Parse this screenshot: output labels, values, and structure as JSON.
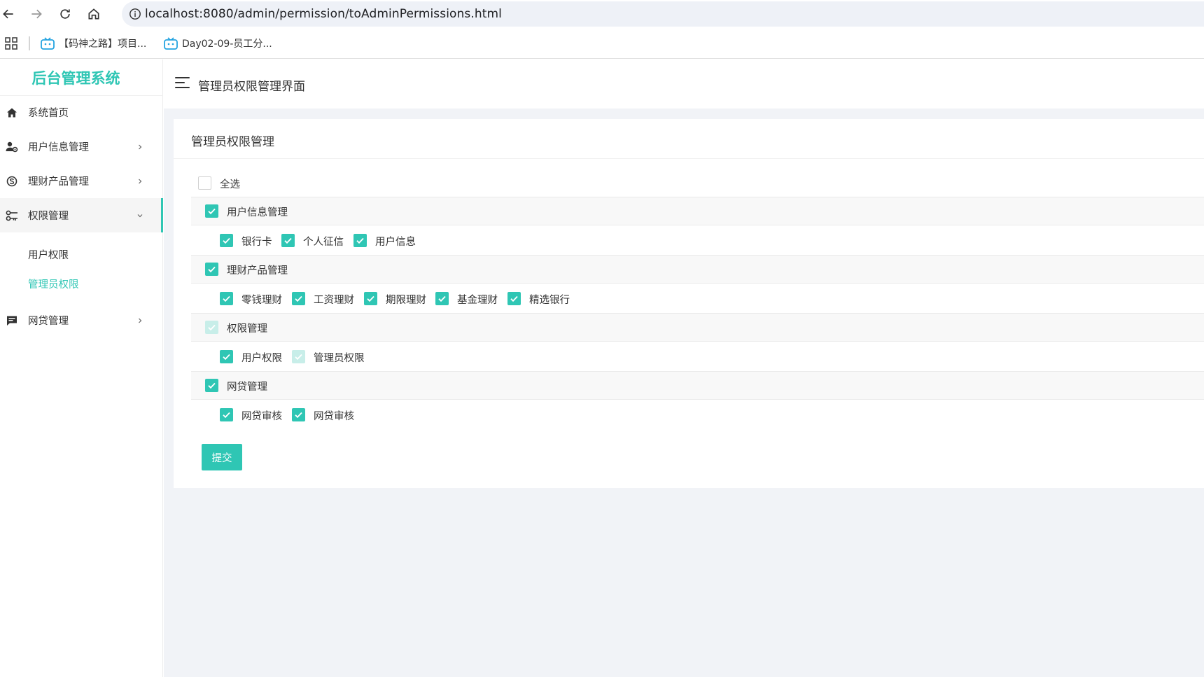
{
  "browser": {
    "url": "localhost:8080/admin/permission/toAdminPermissions.html",
    "bookmarks": [
      "【码神之路】项目...",
      "Day02-09-员工分..."
    ]
  },
  "sidebar": {
    "logo": "后台管理系统",
    "items": [
      {
        "label": "系统首页",
        "icon": "home-icon"
      },
      {
        "label": "用户信息管理",
        "icon": "user-settings-icon"
      },
      {
        "label": "理财产品管理",
        "icon": "skype-icon"
      },
      {
        "label": "权限管理",
        "icon": "key-icon"
      },
      {
        "label": "网贷管理",
        "icon": "message-icon"
      }
    ],
    "sub_items": [
      "用户权限",
      "管理员权限"
    ]
  },
  "header": {
    "title": "管理员权限管理界面"
  },
  "card": {
    "title": "管理员权限管理",
    "select_all": "全选",
    "groups": [
      {
        "label": "用户信息管理",
        "children": [
          "银行卡",
          "个人征信",
          "用户信息"
        ]
      },
      {
        "label": "理财产品管理",
        "children": [
          "零钱理财",
          "工资理财",
          "期限理财",
          "基金理财",
          "精选银行"
        ]
      },
      {
        "label": "权限管理",
        "children": [
          "用户权限",
          "管理员权限"
        ]
      },
      {
        "label": "网贷管理",
        "children": [
          "网贷审核",
          "网贷审核"
        ]
      }
    ],
    "submit": "提交"
  },
  "colors": {
    "accent": "#2fc6b4",
    "accent_disabled": "#c8eee9",
    "background": "#f1f3f7"
  }
}
